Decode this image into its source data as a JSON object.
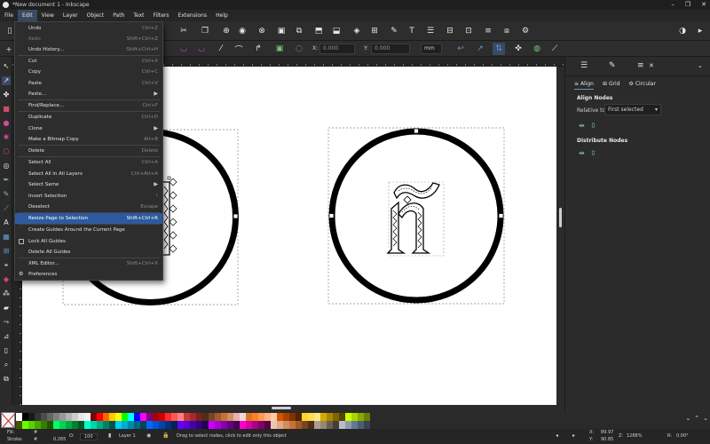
{
  "window": {
    "title": "*New document 1 - Inkscape",
    "buttons": [
      "–",
      "❐",
      "✕"
    ]
  },
  "menubar": {
    "items": [
      "File",
      "Edit",
      "View",
      "Layer",
      "Object",
      "Path",
      "Text",
      "Filters",
      "Extensions",
      "Help"
    ],
    "active": "Edit"
  },
  "edit_menu": {
    "items": [
      {
        "label": "Undo",
        "shortcut": "Ctrl+Z"
      },
      {
        "label": "Redo",
        "shortcut": "Shift+Ctrl+Z",
        "disabled": true
      },
      {
        "label": "Undo History...",
        "shortcut": "Shift+Ctrl+H"
      },
      {
        "label": "Cut",
        "shortcut": "Ctrl+X"
      },
      {
        "label": "Copy",
        "shortcut": "Ctrl+C"
      },
      {
        "label": "Paste",
        "shortcut": "Ctrl+V"
      },
      {
        "label": "Paste...",
        "submenu": true
      },
      {
        "label": "Find/Replace...",
        "shortcut": "Ctrl+F"
      },
      {
        "label": "Duplicate",
        "shortcut": "Ctrl+D"
      },
      {
        "label": "Clone",
        "submenu": true
      },
      {
        "label": "Make a Bitmap Copy",
        "shortcut": "Alt+B"
      },
      {
        "label": "Delete",
        "shortcut": "Delete"
      },
      {
        "label": "Select All",
        "shortcut": "Ctrl+A"
      },
      {
        "label": "Select All in All Layers",
        "shortcut": "Ctrl+Alt+A"
      },
      {
        "label": "Select Same",
        "submenu": true
      },
      {
        "label": "Invert Selection",
        "shortcut": "!"
      },
      {
        "label": "Deselect",
        "shortcut": "Escape"
      },
      {
        "label": "Resize Page to Selection",
        "shortcut": "Shift+Ctrl+R",
        "highlighted": true
      },
      {
        "label": "Create Guides Around the Current Page",
        "shortcut": ""
      },
      {
        "label": "Lock All Guides",
        "shortcut": ""
      },
      {
        "label": "Delete All Guides",
        "shortcut": ""
      },
      {
        "label": "XML Editor...",
        "shortcut": "Shift+Ctrl+X"
      },
      {
        "label": "Preferences",
        "shortcut": ""
      }
    ]
  },
  "controls": {
    "x_label": "X:",
    "x_value": "0.000",
    "y_label": "Y:",
    "y_value": "0.000",
    "unit": "mm"
  },
  "right_panel": {
    "subtabs": [
      "Align",
      "Grid",
      "Circular"
    ],
    "align_nodes_heading": "Align Nodes",
    "relative_to_label": "Relative to:",
    "relative_to_value": "First selected",
    "distribute_nodes_heading": "Distribute Nodes"
  },
  "palette": {
    "swatches": [
      "#ffffff",
      "#000000",
      "#1a1a1a",
      "#333333",
      "#4d4d4d",
      "#666666",
      "#808080",
      "#999999",
      "#b3b3b3",
      "#cccccc",
      "#e6e6e6",
      "#f2f2f2",
      "#800000",
      "#ff0000",
      "#ff6600",
      "#ffcc00",
      "#ffff00",
      "#00ff00",
      "#00ffff",
      "#0000ff",
      "#ff00ff",
      "#800080",
      "#aa0000",
      "#d40000",
      "#ff2a2a",
      "#ff5555",
      "#ff8080",
      "#c83737",
      "#a02c2c",
      "#782121",
      "#502d16",
      "#784421",
      "#a05a2c",
      "#c87137",
      "#d38d5f",
      "#e9afaf",
      "#f4d7d7",
      "#dd7722",
      "#ff7f2a",
      "#ff9955",
      "#ffb380",
      "#ffccaa",
      "#d45500",
      "#aa4400",
      "#803300",
      "#552200",
      "#ffd42a",
      "#ffdd55",
      "#ffe680",
      "#d4aa00",
      "#aa8800",
      "#806600",
      "#554400",
      "#ccff00",
      "#aad400",
      "#88aa00",
      "#668000",
      "#445500",
      "#66ff00",
      "#55d400",
      "#44aa00",
      "#338000",
      "#225500",
      "#00ff66",
      "#00d455",
      "#00aa44",
      "#008033",
      "#005522",
      "#00ffcc",
      "#00d4aa",
      "#00aa88",
      "#008066",
      "#005544",
      "#00ccff",
      "#00aad4",
      "#0088aa",
      "#006680",
      "#004455",
      "#0066ff",
      "#0055d4",
      "#0044aa",
      "#003380",
      "#002255",
      "#6600ff",
      "#5500d4",
      "#4400aa",
      "#330080",
      "#220055",
      "#cc00ff",
      "#aa00d4",
      "#8800aa",
      "#660080",
      "#440055",
      "#ff00cc",
      "#d400aa",
      "#aa0088",
      "#800066",
      "#550044",
      "#e9c6af",
      "#deaa87",
      "#d38d5f",
      "#c87137",
      "#a05a2c",
      "#784421",
      "#502d16",
      "#ac9d93",
      "#918a6f",
      "#6c5d53",
      "#483e37",
      "#b7bec8",
      "#8d9aab",
      "#667993",
      "#4d5d73",
      "#374252"
    ]
  },
  "status": {
    "fill_label": "Fill:",
    "fill_value": "#",
    "stroke_label": "Stroke:",
    "stroke_value": "#",
    "stroke_width": "0.265",
    "opacity_label": "O:",
    "opacity_value": "100",
    "layer": "Layer 1",
    "message": "Drag to select nodes, click to edit only this object",
    "x_label": "X:",
    "x_value": "89.97",
    "y_label": "Y:",
    "y_value": "90.85",
    "zoom_label": "Z:",
    "zoom_value": "1288%",
    "rot_label": "R:",
    "rot_value": "0.00°"
  }
}
